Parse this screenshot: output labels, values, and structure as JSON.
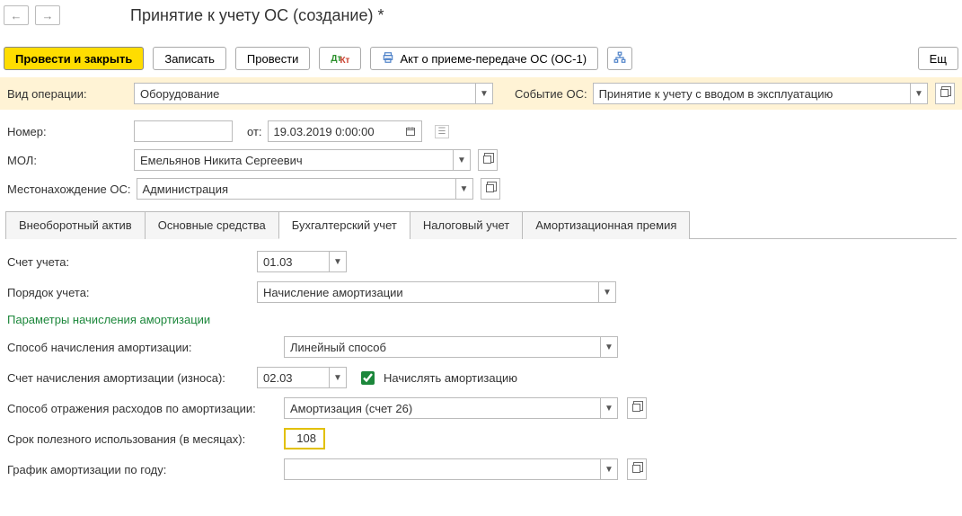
{
  "header": {
    "title": "Принятие к учету ОС (создание) *"
  },
  "toolbar": {
    "post_close": "Провести и закрыть",
    "save": "Записать",
    "post": "Провести",
    "act": "Акт о приеме-передаче ОС (ОС-1)",
    "more": "Ещ"
  },
  "labels": {
    "operation_type": "Вид операции:",
    "event": "Событие ОС:",
    "number": "Номер:",
    "from": "от:",
    "mol": "МОЛ:",
    "location": "Местонахождение ОС:"
  },
  "fields": {
    "operation_type": "Оборудование",
    "event": "Принятие к учету с вводом в эксплуатацию",
    "number": "",
    "date": "19.03.2019  0:00:00",
    "mol": "Емельянов Никита Сергеевич",
    "location": "Администрация"
  },
  "tabs": {
    "t1": "Внеоборотный актив",
    "t2": "Основные средства",
    "t3": "Бухгалтерский учет",
    "t4": "Налоговый учет",
    "t5": "Амортизационная премия"
  },
  "acc": {
    "labels": {
      "account": "Счет учета:",
      "order": "Порядок учета:",
      "section": "Параметры начисления амортизации",
      "method": "Способ начисления амортизации:",
      "depr_account": "Счет начисления амортизации (износа):",
      "depr_check": "Начислять амортизацию",
      "expense": "Способ отражения расходов по амортизации:",
      "life": "Срок полезного использования (в месяцах):",
      "schedule": "График амортизации по году:"
    },
    "values": {
      "account": "01.03",
      "order": "Начисление амортизации",
      "method": "Линейный способ",
      "depr_account": "02.03",
      "expense": "Амортизация (счет 26)",
      "life": "108",
      "schedule": ""
    }
  }
}
